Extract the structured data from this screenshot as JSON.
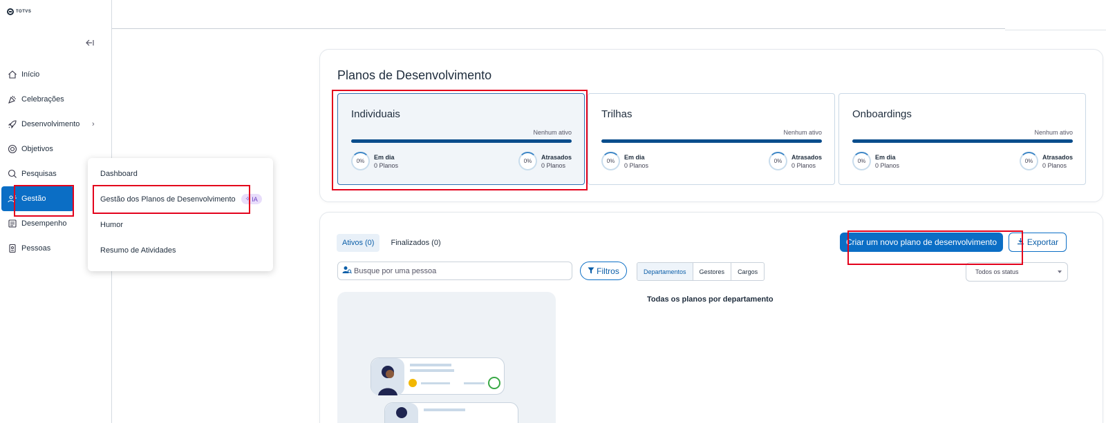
{
  "brand": {
    "logo_text": "TOTVS"
  },
  "sidebar": {
    "collapse_icon": "collapse-left-icon",
    "items": [
      {
        "label": "Início",
        "icon": "home-icon"
      },
      {
        "label": "Celebrações",
        "icon": "party-icon"
      },
      {
        "label": "Desenvolvimento",
        "icon": "rocket-icon",
        "has_submenu": true
      },
      {
        "label": "Objetivos",
        "icon": "target-icon"
      },
      {
        "label": "Pesquisas",
        "icon": "search-icon"
      },
      {
        "label": "Gestão",
        "icon": "gestao-icon",
        "active": true
      },
      {
        "label": "Desempenho",
        "icon": "clipboard-icon"
      },
      {
        "label": "Pessoas",
        "icon": "badge-icon"
      }
    ]
  },
  "flyout": {
    "items": [
      {
        "label": "Dashboard"
      },
      {
        "label": "Gestão dos Planos de Desenvolvimento",
        "badge": "IA"
      },
      {
        "label": "Humor"
      },
      {
        "label": "Resumo de Atividades"
      }
    ]
  },
  "plans": {
    "title": "Planos de Desenvolvimento",
    "cards": [
      {
        "title": "Individuais",
        "status": "Nenhum ativo",
        "on_time_label": "Em dia",
        "on_time_count": "0 Planos",
        "on_time_pct": "0%",
        "late_label": "Atrasados",
        "late_count": "0 Planos",
        "late_pct": "0%"
      },
      {
        "title": "Trilhas",
        "status": "Nenhum ativo",
        "on_time_label": "Em dia",
        "on_time_count": "0 Planos",
        "on_time_pct": "0%",
        "late_label": "Atrasados",
        "late_count": "0 Planos",
        "late_pct": "0%"
      },
      {
        "title": "Onboardings",
        "status": "Nenhum ativo",
        "on_time_label": "Em dia",
        "on_time_count": "0 Planos",
        "on_time_pct": "0%",
        "late_label": "Atrasados",
        "late_count": "0 Planos",
        "late_pct": "0%"
      }
    ]
  },
  "list": {
    "tabs": [
      {
        "label": "Ativos (0)"
      },
      {
        "label": "Finalizados (0)"
      }
    ],
    "create_button": "Criar um novo plano de desenvolvimento",
    "export_button": "Exportar",
    "search_placeholder": "Busque por uma pessoa",
    "filter_button": "Filtros",
    "segments": [
      {
        "label": "Departamentos"
      },
      {
        "label": "Gestores"
      },
      {
        "label": "Cargos"
      }
    ],
    "status_select": "Todos os status",
    "department_title": "Todas os planos por departamento"
  },
  "colors": {
    "primary": "#0b6ec5",
    "dark_bar": "#0a4d8c",
    "highlight": "#e3001b",
    "ia_badge_bg": "#e8ddfb"
  }
}
